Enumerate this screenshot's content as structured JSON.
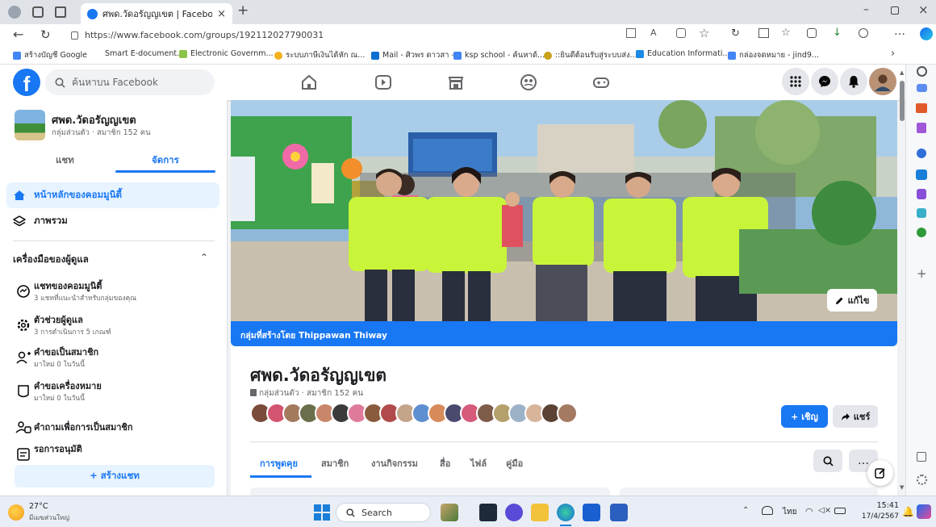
{
  "browser": {
    "tab_title": "ศพด.วัดอรัญญเขต | Facebook",
    "url": "https://www.facebook.com/groups/192112027790031",
    "favorites": [
      "สร้างบัญชี Google",
      "Smart E-document...",
      "Electronic Governm...",
      "ระบบภาษีเงินได้หัก ณ...",
      "Mail - ศิวพร ดาวสา -...",
      "ksp school - ค้นหาด้...",
      "::ยินดีต้อนรับสู่ระบบส่ง...",
      "Education Informati...",
      "กล่องจดหมาย - jind9..."
    ]
  },
  "fb": {
    "search_placeholder": "ค้นหาบน Facebook"
  },
  "group": {
    "name": "ศพด.วัดอรัญญเขต",
    "privacy": "กลุ่มส่วนตัว · สมาชิก 152 คน",
    "created_by": "กลุ่มที่สร้างโดย Thippawan Thiway",
    "edit_label": "แก้ไข",
    "invite_label": "+ เชิญ",
    "share_label": "แชร์"
  },
  "sidebar": {
    "tabs": [
      "แชท",
      "จัดการ"
    ],
    "nav": [
      "หน้าหลักของคอมมูนิตี้",
      "ภาพรวม"
    ],
    "tools_header": "เครื่องมือของผู้ดูแล",
    "tools": [
      {
        "title": "แชทของคอมมูนิตี้",
        "sub": "3 แชทที่แนะนำสำหรับกลุ่มของคุณ"
      },
      {
        "title": "ตัวช่วยผู้ดูแล",
        "sub": "3 การดำเนินการ 5 เกณฑ์"
      },
      {
        "title": "คำขอเป็นสมาชิก",
        "sub": "มาใหม่ 0 ในวันนี้"
      },
      {
        "title": "คำขอเครื่องหมาย",
        "sub": "มาใหม่ 0 ในวันนี้"
      },
      {
        "title": "คำถามเพื่อการเป็นสมาชิก",
        "sub": ""
      },
      {
        "title": "รอการอนุมัติ",
        "sub": ""
      }
    ],
    "create_chat": "+ สร้างแชท"
  },
  "group_tabs": [
    "การพูดคุย",
    "สมาชิก",
    "งานกิจกรรม",
    "สื่อ",
    "ไฟล์",
    "คู่มือ"
  ],
  "taskbar": {
    "weather_temp": "27°C",
    "weather_desc": "มีเมฆส่วนใหญ่",
    "search": "Search",
    "lang": "ไทย",
    "time": "15:41",
    "date": "17/4/2567"
  },
  "colors": {
    "fb_blue": "#1877f2",
    "shirt": "#c8f53a"
  }
}
